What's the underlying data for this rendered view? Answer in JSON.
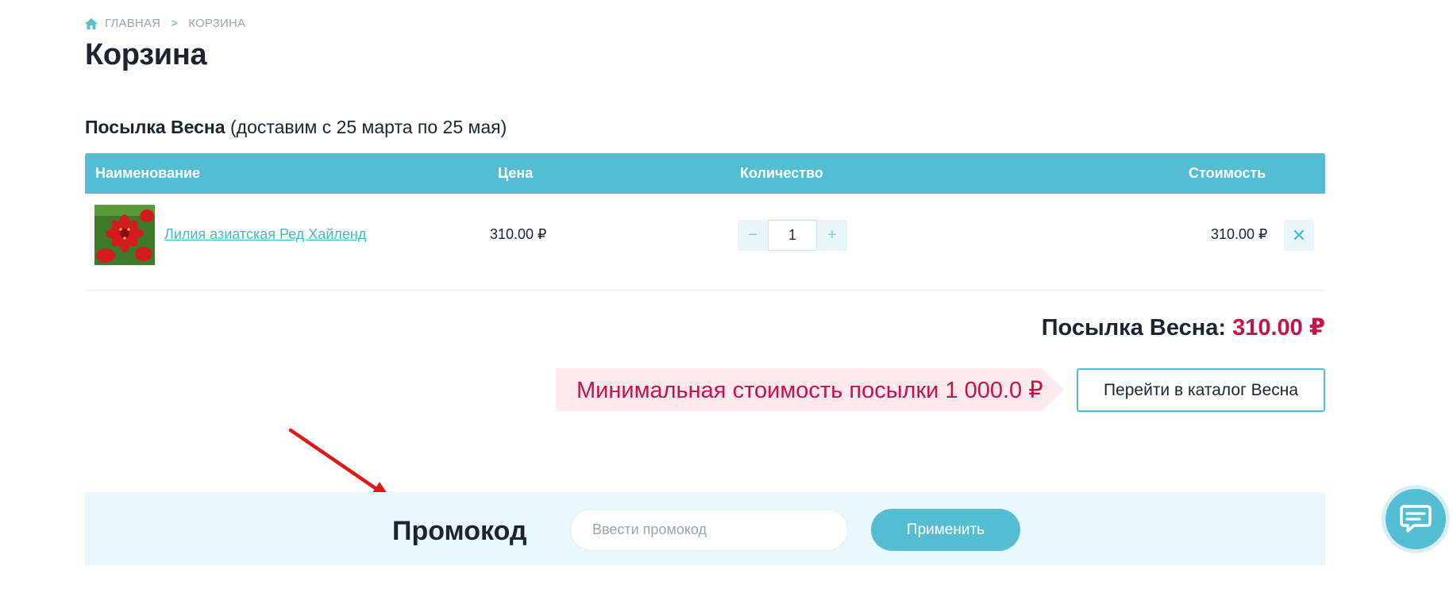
{
  "breadcrumb": {
    "home": "ГЛАВНАЯ",
    "separator": ">",
    "current": "КОРЗИНА"
  },
  "page": {
    "title": "Корзина"
  },
  "section": {
    "title": "Посылка Весна",
    "subtitle": "(доставим с 25 марта по 25 мая)"
  },
  "table": {
    "headers": {
      "name": "Наименование",
      "price": "Цена",
      "quantity": "Количество",
      "total": "Стоимость"
    },
    "rows": [
      {
        "name": "Лилия азиатская Ред Хайленд",
        "price": "310.00 ₽",
        "quantity": "1",
        "total": "310.00 ₽"
      }
    ]
  },
  "stepper": {
    "minus": "−",
    "plus": "+"
  },
  "remove": {
    "label": "✕"
  },
  "summary": {
    "label": "Посылка Весна:",
    "amount": "310.00 ₽"
  },
  "notice": {
    "min_text": "Минимальная стоимость посылки 1 000.0 ₽"
  },
  "catalog_button": {
    "label": "Перейти в каталог Весна"
  },
  "promo": {
    "title": "Промокод",
    "placeholder": "Ввести промокод",
    "apply_label": "Применить"
  },
  "colors": {
    "accent": "#55bdd1",
    "price_red": "#c51249",
    "notice_bg": "#fde8ee",
    "promo_bg": "#e9f8fc",
    "annotation": "#e01818"
  },
  "icons": {
    "home": "home-icon",
    "remove": "close-icon",
    "chat": "chat-icon",
    "annotation": "annotation-arrow"
  }
}
